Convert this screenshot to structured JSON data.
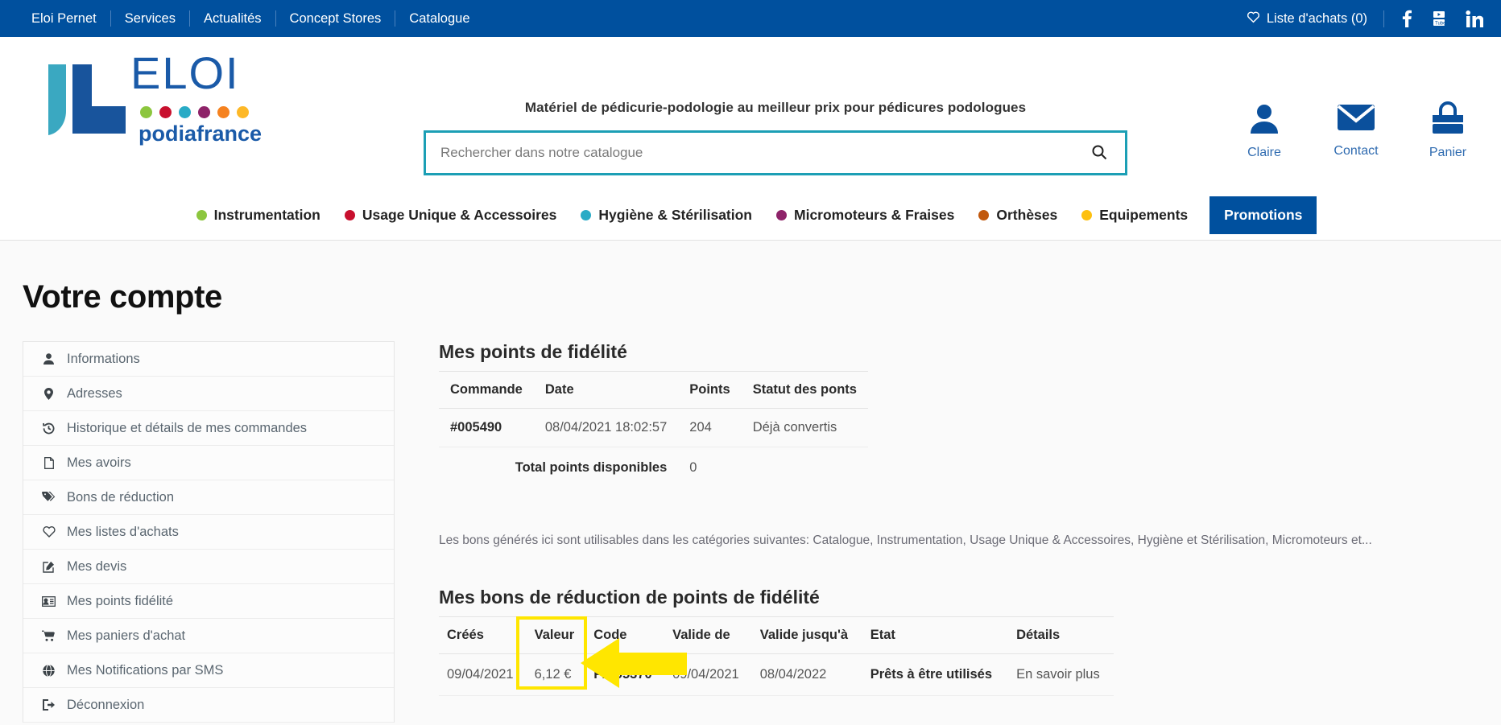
{
  "topbar": {
    "links": [
      "Eloi Pernet",
      "Services",
      "Actualités",
      "Concept Stores",
      "Catalogue"
    ],
    "wishlist_label": "Liste d'achats (0)",
    "social": [
      "facebook-icon",
      "youtube-icon",
      "linkedin-icon"
    ]
  },
  "header": {
    "logo_main": "ELOI",
    "logo_sub": "podiafrance",
    "logo_dot_colors": [
      "#8cc63e",
      "#c8102e",
      "#29abc6",
      "#8e2369",
      "#f5821f",
      "#fdb827"
    ],
    "tagline": "Matériel de pédicurie-podologie au meilleur prix pour pédicures podologues",
    "search_placeholder": "Rechercher dans notre catalogue",
    "search_value": "",
    "search_icon": "search-icon",
    "account": [
      {
        "icon": "user-icon",
        "label": "Claire"
      },
      {
        "icon": "envelope-icon",
        "label": "Contact"
      },
      {
        "icon": "bag-icon",
        "label": "Panier"
      }
    ]
  },
  "catnav": {
    "items": [
      {
        "label": "Instrumentation",
        "color": "#8cc63e"
      },
      {
        "label": "Usage Unique & Accessoires",
        "color": "#c8102e"
      },
      {
        "label": "Hygiène & Stérilisation",
        "color": "#29abc6"
      },
      {
        "label": "Micromoteurs & Fraises",
        "color": "#8e2369"
      },
      {
        "label": "Orthèses",
        "color": "#c1580d"
      },
      {
        "label": "Equipements",
        "color": "#fdc010"
      }
    ],
    "promo_label": "Promotions",
    "promo_color": "#00509e"
  },
  "page": {
    "title": "Votre compte"
  },
  "sidebar": {
    "items": [
      {
        "label": "Informations",
        "icon": "user-icon"
      },
      {
        "label": "Adresses",
        "icon": "map-pin-icon"
      },
      {
        "label": "Historique et détails de mes commandes",
        "icon": "history-icon"
      },
      {
        "label": "Mes avoirs",
        "icon": "file-icon"
      },
      {
        "label": "Bons de réduction",
        "icon": "tags-icon"
      },
      {
        "label": "Mes listes d'achats",
        "icon": "heart-icon"
      },
      {
        "label": "Mes devis",
        "icon": "edit-icon"
      },
      {
        "label": "Mes points fidélité",
        "icon": "id-card-icon"
      },
      {
        "label": "Mes paniers d'achat",
        "icon": "cart-icon"
      },
      {
        "label": "Mes Notifications par SMS",
        "icon": "globe-icon"
      },
      {
        "label": "Déconnexion",
        "icon": "logout-icon"
      }
    ]
  },
  "points": {
    "title": "Mes points de fidélité",
    "headers": [
      "Commande",
      "Date",
      "Points",
      "Statut des ponts"
    ],
    "rows": [
      {
        "commande": "#005490",
        "date": "08/04/2021 18:02:57",
        "points": "204",
        "statut": "Déjà convertis"
      }
    ],
    "total_label": "Total points disponibles",
    "total_value": "0"
  },
  "note": "Les bons générés ici sont utilisables dans les catégories suivantes: Catalogue, Instrumentation, Usage Unique & Accessoires, Hygiène et Stérilisation, Micromoteurs et...",
  "vouchers": {
    "title": "Mes bons de réduction de points de fidélité",
    "headers": [
      "Créés",
      "Valeur",
      "Code",
      "Valide de",
      "Valide jusqu'à",
      "Etat",
      "Détails"
    ],
    "rows": [
      {
        "crees": "09/04/2021",
        "valeur": "6,12 €",
        "code": "FID95370",
        "valide_de": "09/04/2021",
        "valide_jusqua": "08/04/2022",
        "etat": "Prêts à être utilisés",
        "details": "En savoir plus"
      }
    ]
  },
  "annotation": {
    "highlight_color": "#ffe600",
    "arrow_color": "#ffe600",
    "arrow_direction": "left",
    "target": "code-cell"
  }
}
